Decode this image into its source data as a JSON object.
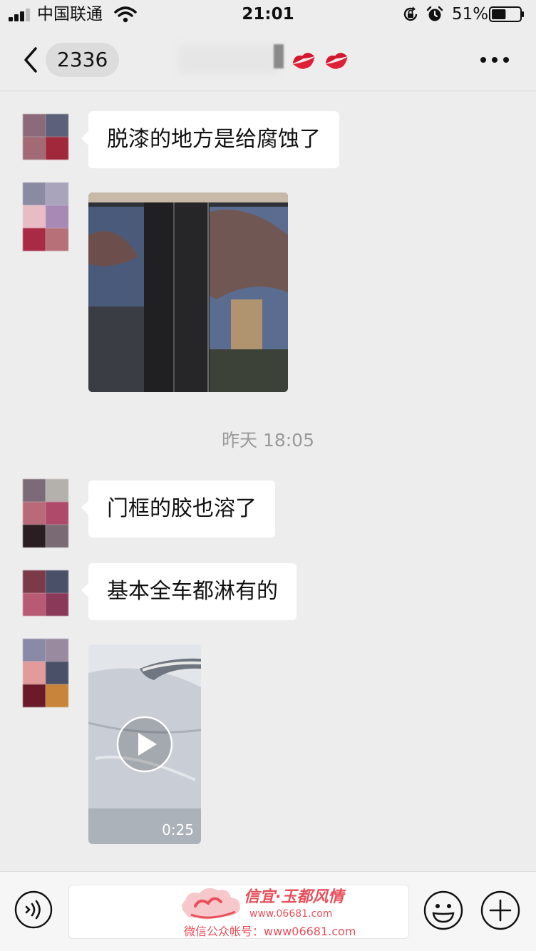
{
  "status_bar": {
    "carrier": "中国联通",
    "time": "21:01",
    "battery_percent": "51%",
    "battery_level": 0.51
  },
  "nav": {
    "unread_count": "2336",
    "title_emoji": [
      "kiss-mark-icon",
      "kiss-mark-icon"
    ]
  },
  "messages": [
    {
      "type": "text",
      "text": "脱漆的地方是给腐蚀了"
    },
    {
      "type": "image",
      "content": "car-door-pillar-photo"
    },
    {
      "type": "time",
      "text": "昨天 18:05"
    },
    {
      "type": "text",
      "text": "门框的胶也溶了"
    },
    {
      "type": "text",
      "text": "基本全车都淋有的"
    },
    {
      "type": "video",
      "duration": "0:25"
    }
  ],
  "watermark": {
    "brand": "信宜·玉都风情",
    "url": "www.06681.com",
    "account": "微信公众帐号：www06681.com"
  },
  "colors": {
    "background": "#ededed",
    "bubble": "#ffffff",
    "watermark": "#e8505b"
  }
}
